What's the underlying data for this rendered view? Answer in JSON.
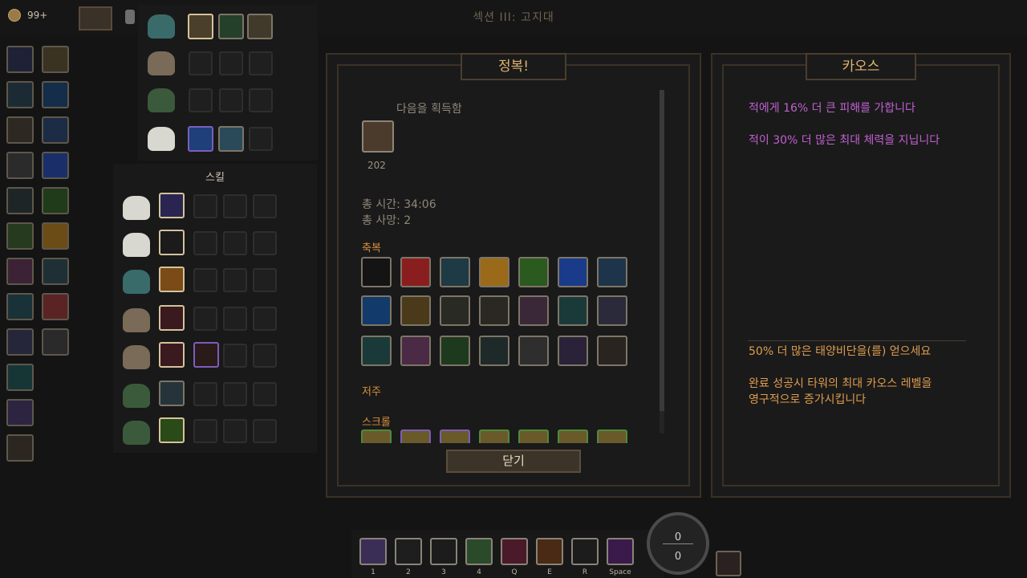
{
  "top_bar": {
    "currency_count": "99+",
    "section_title": "섹션 III: 고지대"
  },
  "skills_panel": {
    "title": "스킬"
  },
  "conquest": {
    "title": "정복!",
    "acquired_label": "다음을 획득함",
    "acquired_item_count": "202",
    "total_time": "총 시간: 34:06",
    "total_deaths": "총 사망: 2",
    "blessings_label": "축복",
    "curses_label": "저주",
    "scrolls_label": "스크롤",
    "close_button": "닫기"
  },
  "chaos": {
    "title": "카오스",
    "effects": [
      "적에게 16% 더 큰 피해를 가합니다",
      "적이 30% 더 많은 최대 체력을 지닙니다"
    ],
    "rewards": [
      "50% 더 많은 태양비단을(를) 얻으세요",
      "완료 성공시 타워의 최대 카오스 레벨을",
      "영구적으로 증가시킵니다"
    ],
    "colors": {
      "effect": "#c060d0",
      "reward": "#df9d4f"
    }
  },
  "hotbar": {
    "keys": [
      "1",
      "2",
      "3",
      "4",
      "Q",
      "E",
      "R",
      "Space"
    ]
  },
  "gauge": {
    "top": "0",
    "bottom": "0"
  },
  "icons": {
    "blessings_row1": [
      "sparkle-icon",
      "red-shield-icon",
      "armor-icon",
      "golden-cross-icon",
      "green-flame-icon",
      "blue-banner-icon",
      "blue-star-icon"
    ],
    "blessings_row2": [
      "vortex-icon",
      "lightning-icon",
      "bull-icon",
      "roots-icon",
      "altar-icon",
      "leaf-cluster-icon",
      "boot-icon"
    ],
    "blessings_row3": [
      "green-totem-icon",
      "cake-icon",
      "potion-icon",
      "rain-icon",
      "frame-icon",
      "scythe-icon",
      "candle-icon"
    ]
  }
}
